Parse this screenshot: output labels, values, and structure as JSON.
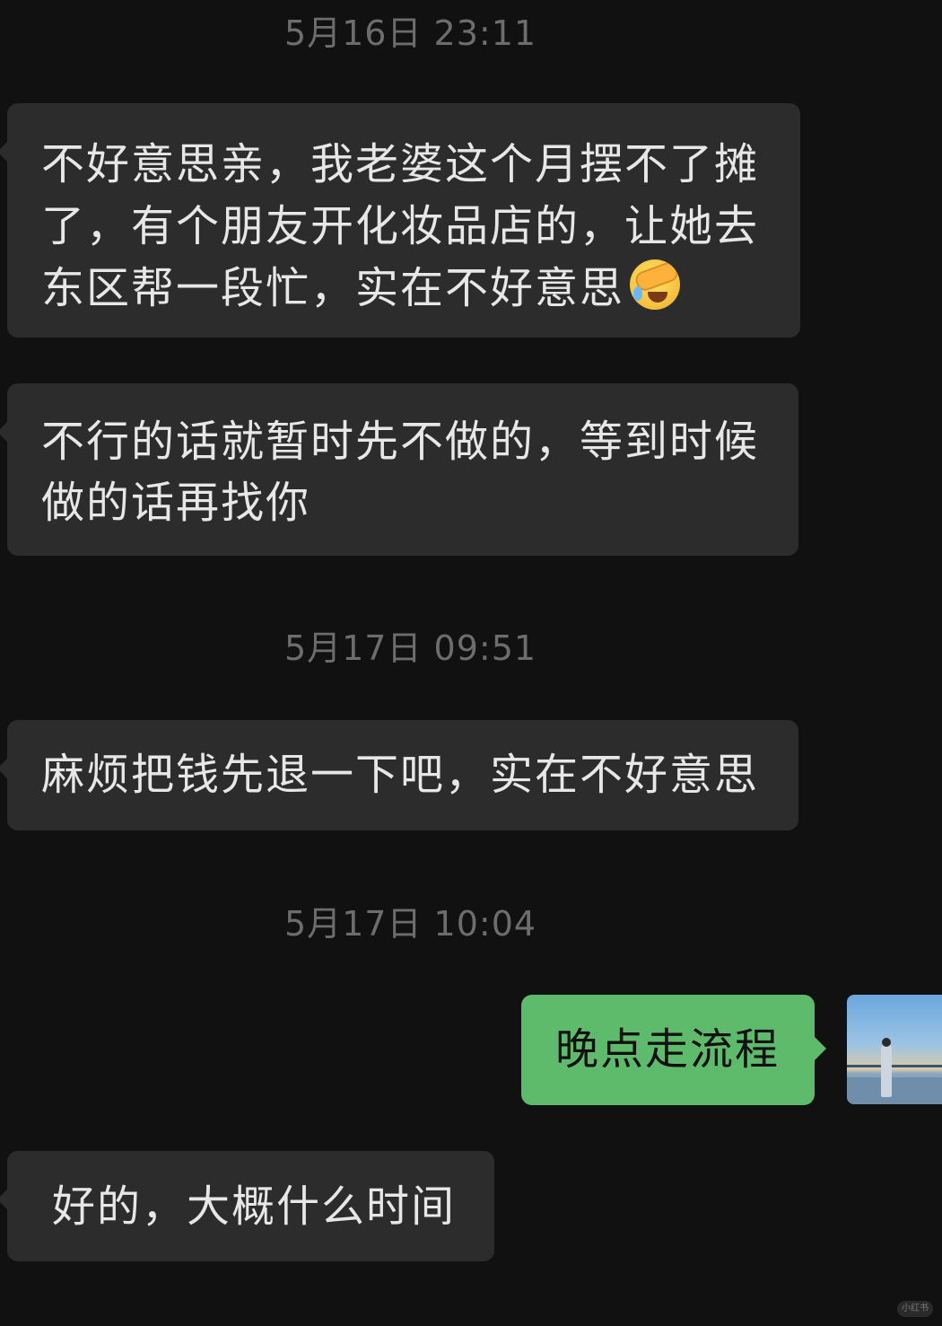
{
  "conversation": {
    "timestamps": {
      "t1": "5月16日 23:11",
      "t2": "5月17日 09:51",
      "t3": "5月17日 10:04"
    },
    "messages": {
      "m1": {
        "line1": "不好意思亲，我老婆这个月摆不了摊",
        "line2": "了，有个朋友开化妆品店的，让她去",
        "line3": "东区帮一段忙，实在不好意思"
      },
      "m2": {
        "line1": "不行的话就暂时先不做的，等到时候",
        "line2": "做的话再找你"
      },
      "m3": {
        "text": "麻烦把钱先退一下吧，实在不好意思"
      },
      "m4": {
        "text": "晚点走流程"
      },
      "m5": {
        "text": "好的，大概什么时间"
      }
    },
    "emoji": "crying-face-with-hand-emoji",
    "watermark": "小红书"
  },
  "colors": {
    "background": "#111111",
    "incoming_bubble": "#2c2c2c",
    "outgoing_bubble": "#5fbb6c",
    "timestamp": "#6d6d6d"
  }
}
